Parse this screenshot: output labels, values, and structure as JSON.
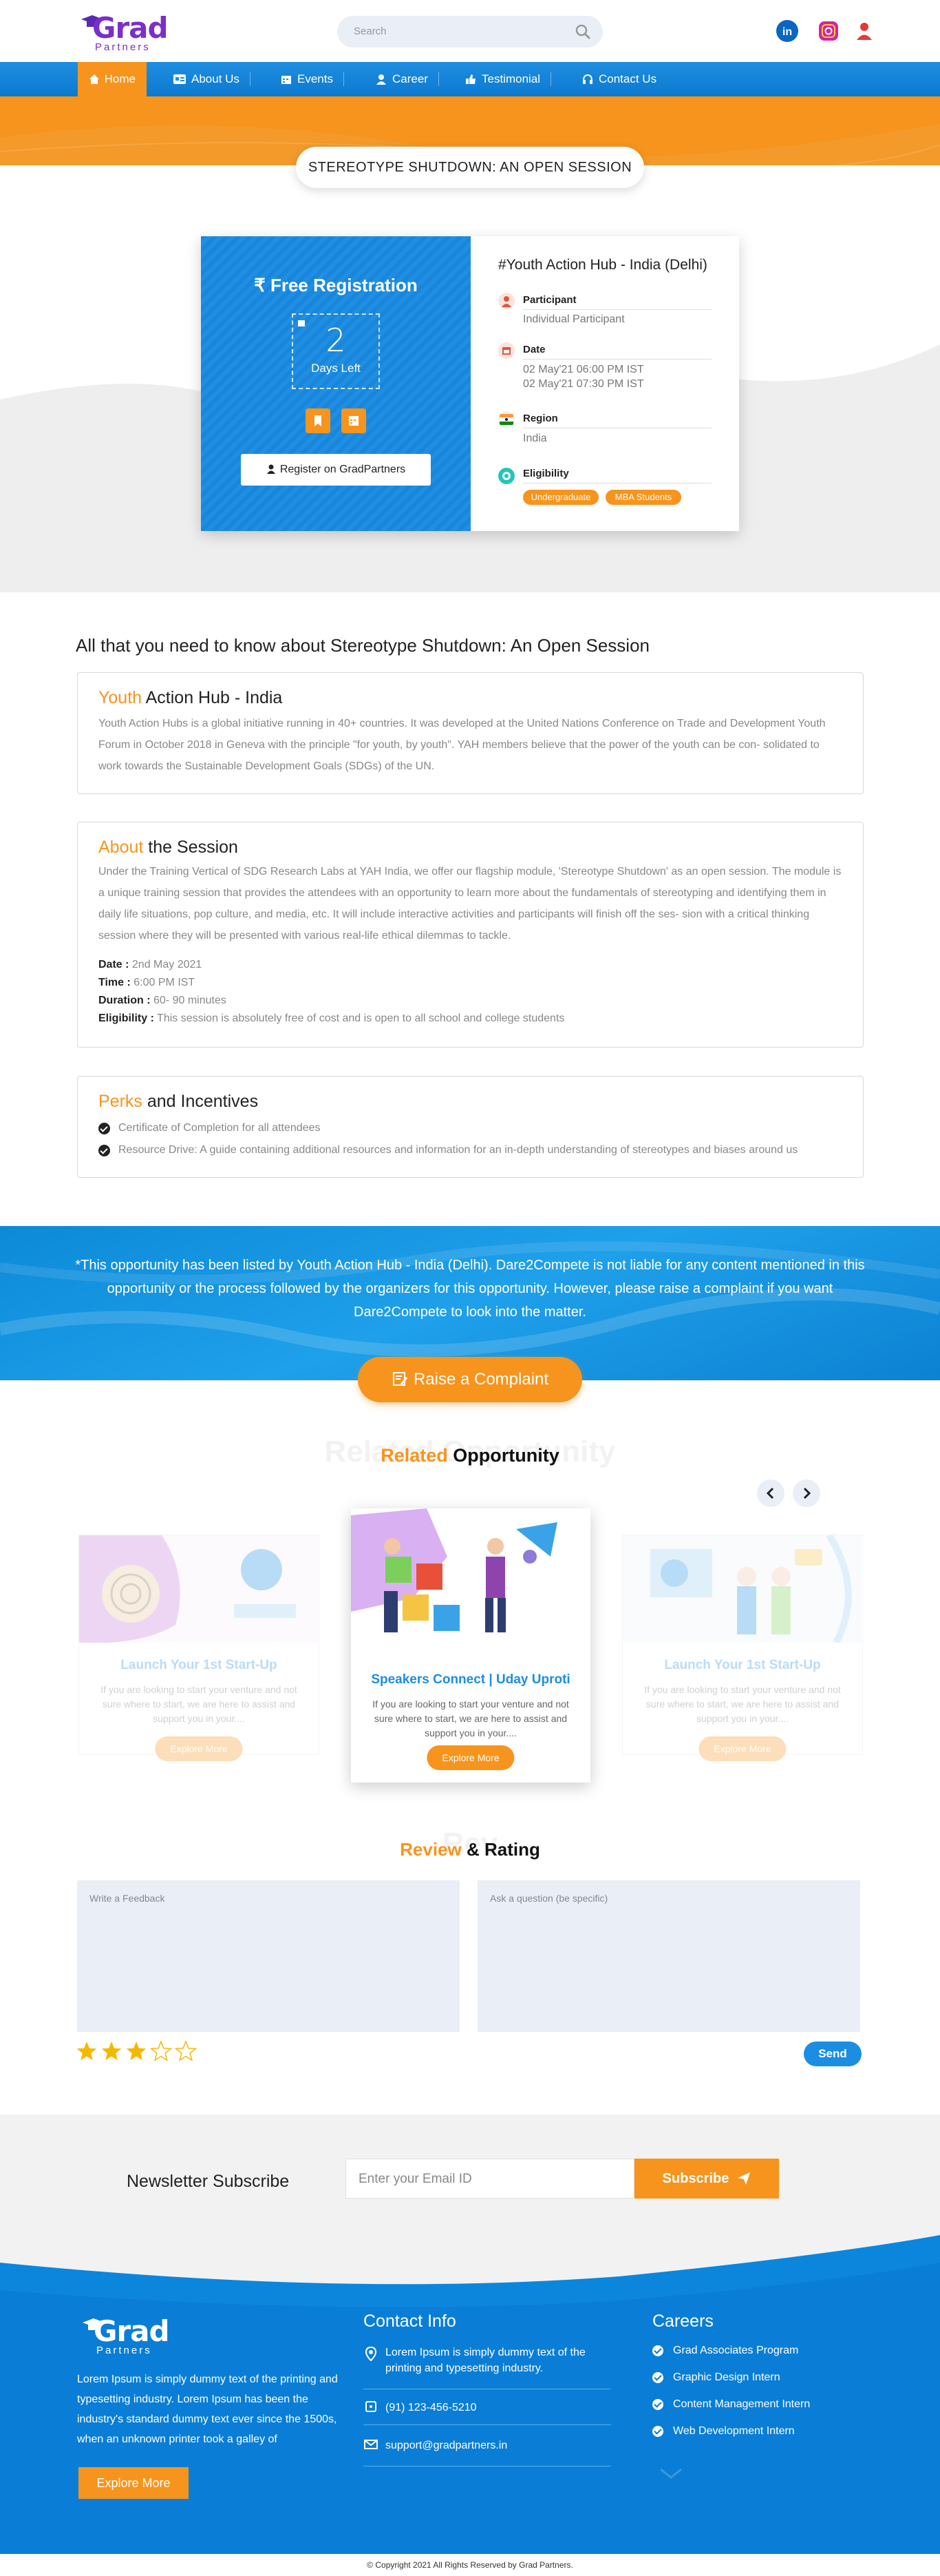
{
  "header": {
    "logo_word": "Grad",
    "logo_sub": "Partners",
    "search_placeholder": "Search"
  },
  "nav": [
    {
      "label": "Home"
    },
    {
      "label": "About Us"
    },
    {
      "label": "Events"
    },
    {
      "label": "Career"
    },
    {
      "label": "Testimonial"
    },
    {
      "label": "Contact Us"
    }
  ],
  "page_title": "STEREOTYPE SHUTDOWN: AN OPEN SESSION",
  "registration": {
    "heading": "₹ Free Registration",
    "days_number": "2",
    "days_label": "Days Left",
    "button": "Register on GradPartners"
  },
  "event_info": {
    "title": "#Youth Action Hub - India (Delhi)",
    "participant_label": "Participant",
    "participant_value": "Individual Participant",
    "date_label": "Date",
    "date_start": "02 May'21 06:00 PM IST",
    "date_end": "02 May'21 07:30 PM IST",
    "region_label": "Region",
    "region_value": "India",
    "eligibility_label": "Eligibility",
    "eligibility_tags": [
      "Undergraduate",
      "MBA Students"
    ]
  },
  "about_heading": "All that you need to know about Stereotype Shutdown: An Open Session",
  "hub_section": {
    "title_highlight": "Youth",
    "title_rest": " Action Hub - India",
    "body": "Youth Action Hubs is a global initiative running in 40+ countries. It was developed at the United Nations Conference on Trade and Development Youth Forum in October 2018 in Geneva with the principle \"for youth, by youth\". YAH members believe that the power of the youth can be con- solidated to work towards the Sustainable Development Goals (SDGs) of the UN."
  },
  "session_section": {
    "title_highlight": "About",
    "title_rest": " the Session",
    "body": "Under the Training Vertical of SDG Research Labs at YAH India, we offer our flagship module, 'Stereotype Shutdown' as an open session. The module is a unique training session that provides the attendees with an opportunity to learn more about the fundamentals of stereotyping and identifying them in daily life situations, pop culture, and media, etc. It will include interactive activities and participants will finish off the ses- sion with a critical thinking session where they will be presented with various real-life ethical dilemmas to tackle.",
    "date_label": "Date :",
    "date_value": "2nd May 2021",
    "time_label": "Time :",
    "time_value": "6:00 PM IST",
    "duration_label": "Duration :",
    "duration_value": "60- 90 minutes",
    "eligibility_label": "Eligibility :",
    "eligibility_value": "This session is absolutely free of cost and is open to all school and college students"
  },
  "perks_section": {
    "title_highlight": "Perks",
    "title_rest": " and Incentives",
    "items": [
      "Certificate of Completion for all attendees",
      "Resource Drive: A guide containing additional resources and information for an in-depth understanding of stereotypes and biases around us"
    ]
  },
  "notice": "*This opportunity has been listed by Youth Action Hub - India (Delhi). Dare2Compete is not liable for any content mentioned in this opportunity or the process followed by the organizers for this opportunity. However, please raise a complaint if you want Dare2Compete to look into the matter.",
  "complaint_button": "Raise a Complaint",
  "related": {
    "bg_text": "Related Opportunity",
    "title_highlight": "Related",
    "title_rest": " Opportunity",
    "cards": [
      {
        "title_highlight": "Launch",
        "title_rest": " Your 1st Start-Up",
        "desc": "If you are looking to start your venture and not sure where to start, we are here to assist and support you in your....",
        "button": "Explore More"
      },
      {
        "title_highlight": "Speakers",
        "title_rest": " Connect | Uday Uproti",
        "desc": "If you are looking to start your venture and not sure where to start, we are here to assist and support you in your....",
        "button": "Explore More"
      },
      {
        "title_highlight": "Launch",
        "title_rest": " Your 1st Start-Up",
        "desc": "If you are looking to start your venture and not sure where to start, we are here to assist and support you in your....",
        "button": "Explore More"
      }
    ]
  },
  "review": {
    "bg_text": "Rev",
    "title_highlight": "Review",
    "title_rest": " & Rating",
    "feedback_placeholder": "Write a Feedback",
    "question_placeholder": "Ask a question (be specific)",
    "rating": 3,
    "max_rating": 5,
    "send_button": "Send"
  },
  "newsletter": {
    "label": "Newsletter Subscribe",
    "placeholder": "Enter your Email ID",
    "button": "Subscribe"
  },
  "footer": {
    "description": "Lorem Ipsum is simply dummy text of the printing and typesetting industry. Lorem Ipsum has been the industry's standard dummy text ever since the 1500s, when an unknown printer took a galley of",
    "explore_button": "Explore More",
    "contact_heading": "Contact Info",
    "address": "Lorem Ipsum is simply dummy text of the printing and typesetting industry.",
    "phone": "(91) 123-456-5210",
    "email": "support@gradpartners.in",
    "careers_heading": "Careers",
    "careers": [
      "Grad Associates Program",
      "Graphic Design Intern",
      "Content Management Intern",
      "Web Development Intern"
    ],
    "copyright": "© Copyright 2021 All Rights Reserved by Grad Partners."
  },
  "colors": {
    "accent_orange": "#f7941d",
    "primary_blue": "#1b8ee3",
    "brand_purple": "#7b2fc9"
  }
}
